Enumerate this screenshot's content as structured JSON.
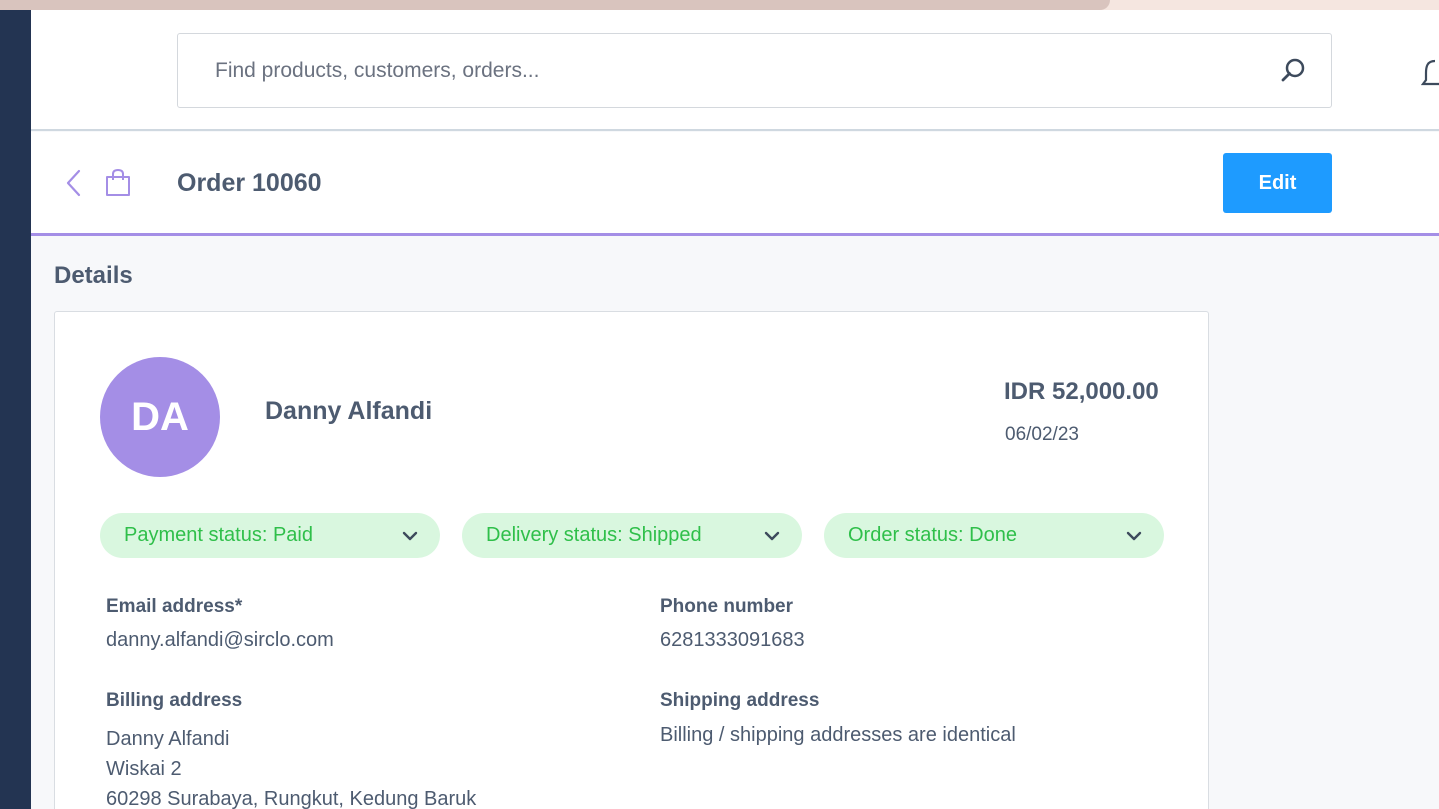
{
  "search": {
    "placeholder": "Find products, customers, orders..."
  },
  "icons": {
    "search": "search-icon",
    "bell": "bell-icon",
    "back": "chevron-left-icon",
    "bag": "shopping-bag-icon",
    "chevron": "chevron-down-icon"
  },
  "colors": {
    "accent": "#a48ee6",
    "primary_button": "#1e9bff",
    "sidebar": "#233452",
    "status_bg": "#d9f7df",
    "status_text": "#2fbf4a"
  },
  "page": {
    "title": "Order 10060",
    "edit_label": "Edit"
  },
  "details": {
    "section_title": "Details",
    "customer": {
      "initials": "DA",
      "name": "Danny Alfandi"
    },
    "total": "IDR 52,000.00",
    "date": "06/02/23",
    "statuses": [
      {
        "label": "Payment status: Paid"
      },
      {
        "label": "Delivery status: Shipped"
      },
      {
        "label": "Order status: Done"
      }
    ],
    "email": {
      "label": "Email address*",
      "value": "danny.alfandi@sirclo.com"
    },
    "phone": {
      "label": "Phone number",
      "value": "6281333091683"
    },
    "billing": {
      "label": "Billing address",
      "lines": [
        "Danny Alfandi",
        "Wiskai 2",
        "60298 Surabaya, Rungkut, Kedung Baruk"
      ]
    },
    "shipping": {
      "label": "Shipping address",
      "value": "Billing / shipping addresses are identical"
    }
  }
}
